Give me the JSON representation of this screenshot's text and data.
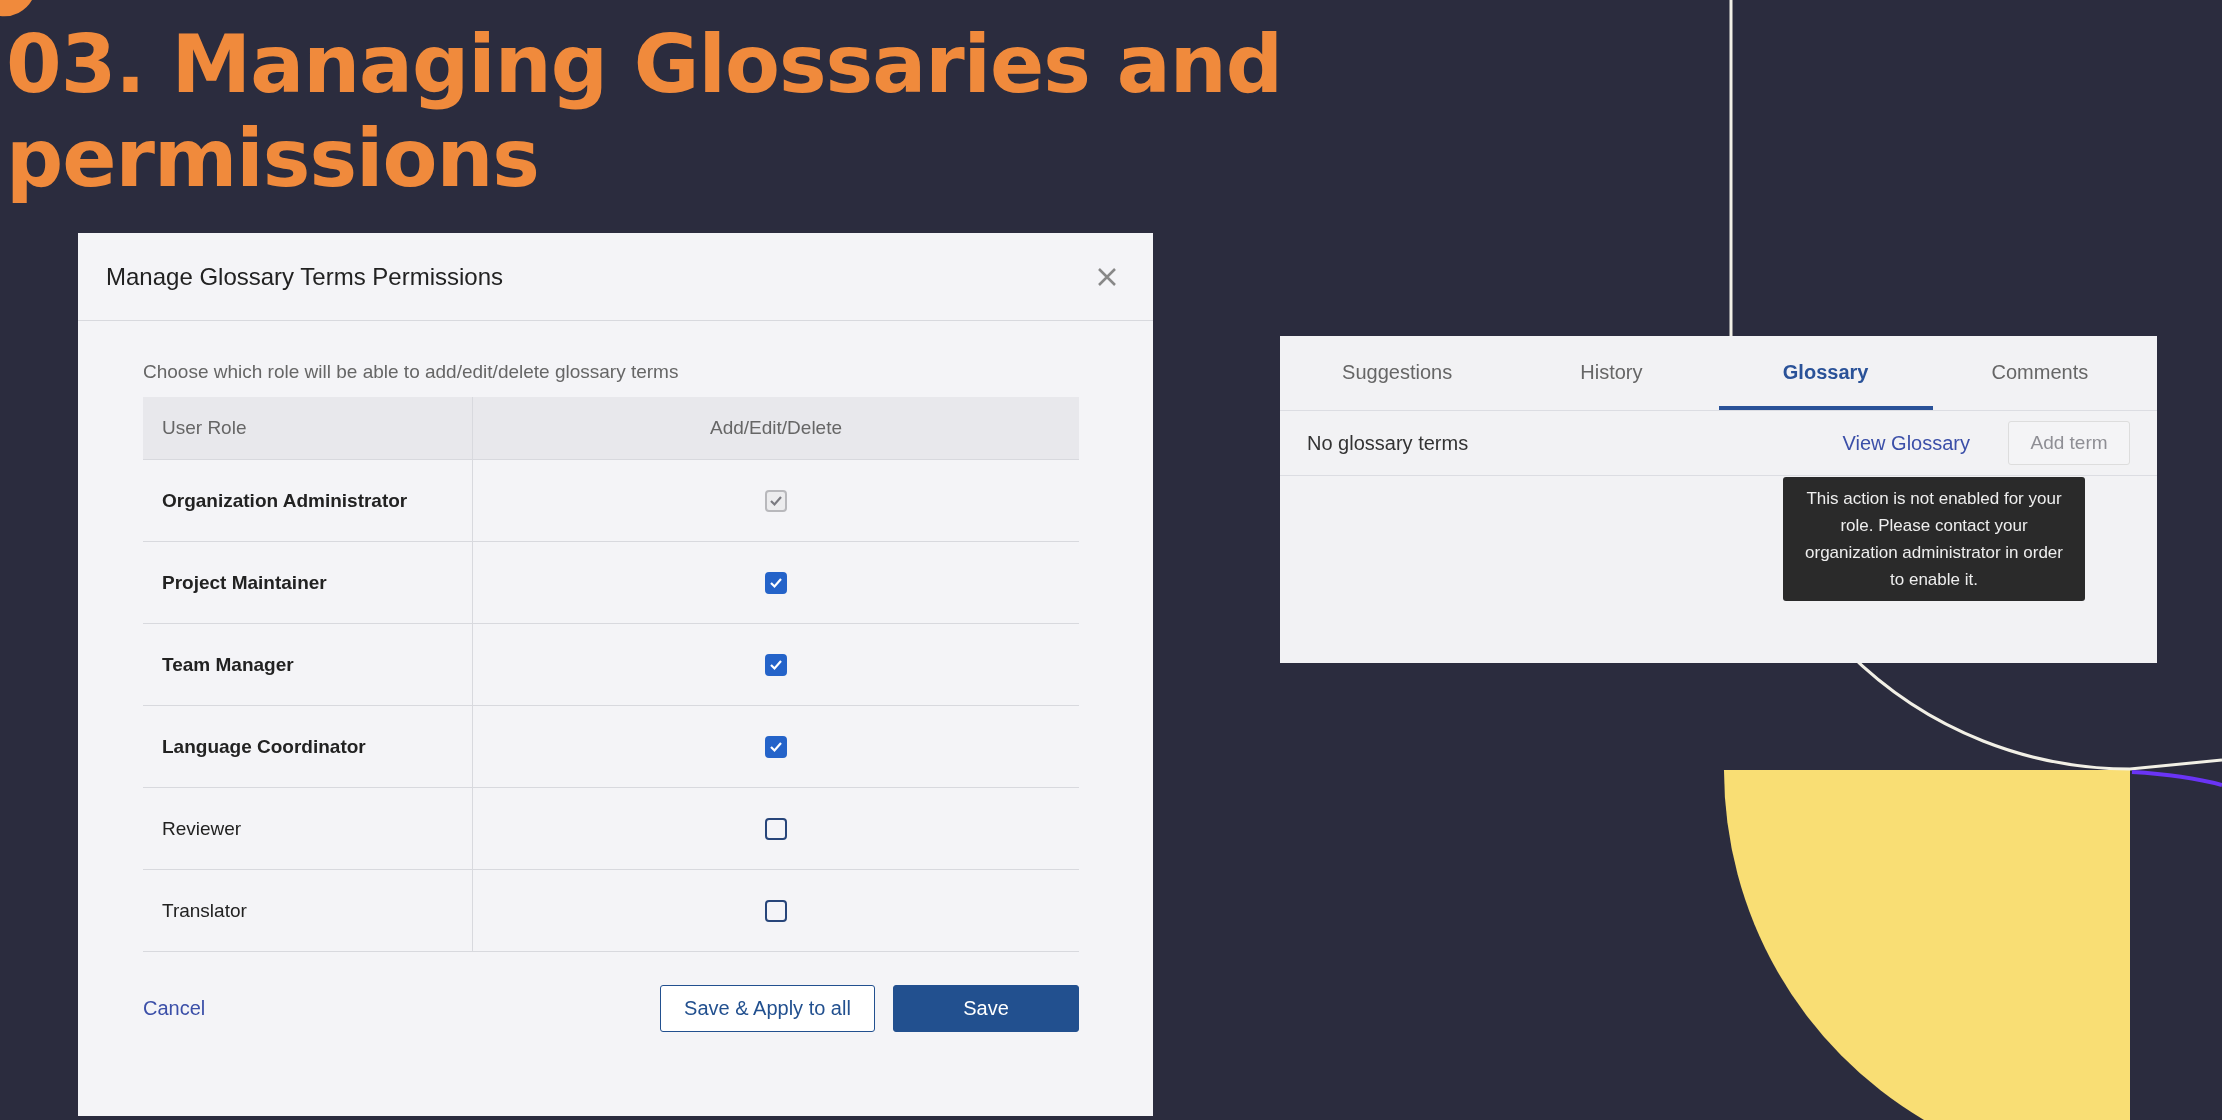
{
  "title": "03. Managing Glossaries and permissions",
  "dialog": {
    "title": "Manage Glossary Terms Permissions",
    "instruction": "Choose which role will be able to add/edit/delete glossary terms",
    "columns": [
      "User Role",
      "Add/Edit/Delete"
    ],
    "rows": [
      {
        "role": "Organization Administrator",
        "bold": true,
        "checked": true,
        "disabled": true
      },
      {
        "role": "Project Maintainer",
        "bold": true,
        "checked": true,
        "disabled": false
      },
      {
        "role": "Team Manager",
        "bold": true,
        "checked": true,
        "disabled": false
      },
      {
        "role": "Language Coordinator",
        "bold": true,
        "checked": true,
        "disabled": false
      },
      {
        "role": "Reviewer",
        "bold": false,
        "checked": false,
        "disabled": false
      },
      {
        "role": "Translator",
        "bold": false,
        "checked": false,
        "disabled": false
      }
    ],
    "cancel": "Cancel",
    "buttons": [
      {
        "label": "Save & Apply to all",
        "kind": "secondary"
      },
      {
        "label": "Save",
        "kind": "primary"
      }
    ]
  },
  "panel": {
    "tabs": [
      {
        "label": "Suggestions",
        "selected": false
      },
      {
        "label": "History",
        "selected": false
      },
      {
        "label": "Glossary",
        "selected": true
      },
      {
        "label": "Comments",
        "selected": false
      }
    ],
    "empty_text": "No glossary terms",
    "link": "View Glossary",
    "add_button": {
      "label": "Add term",
      "disabled": true
    },
    "tooltip": "This action is not enabled for your role. Please contact your organization administrator in order to enable it."
  }
}
